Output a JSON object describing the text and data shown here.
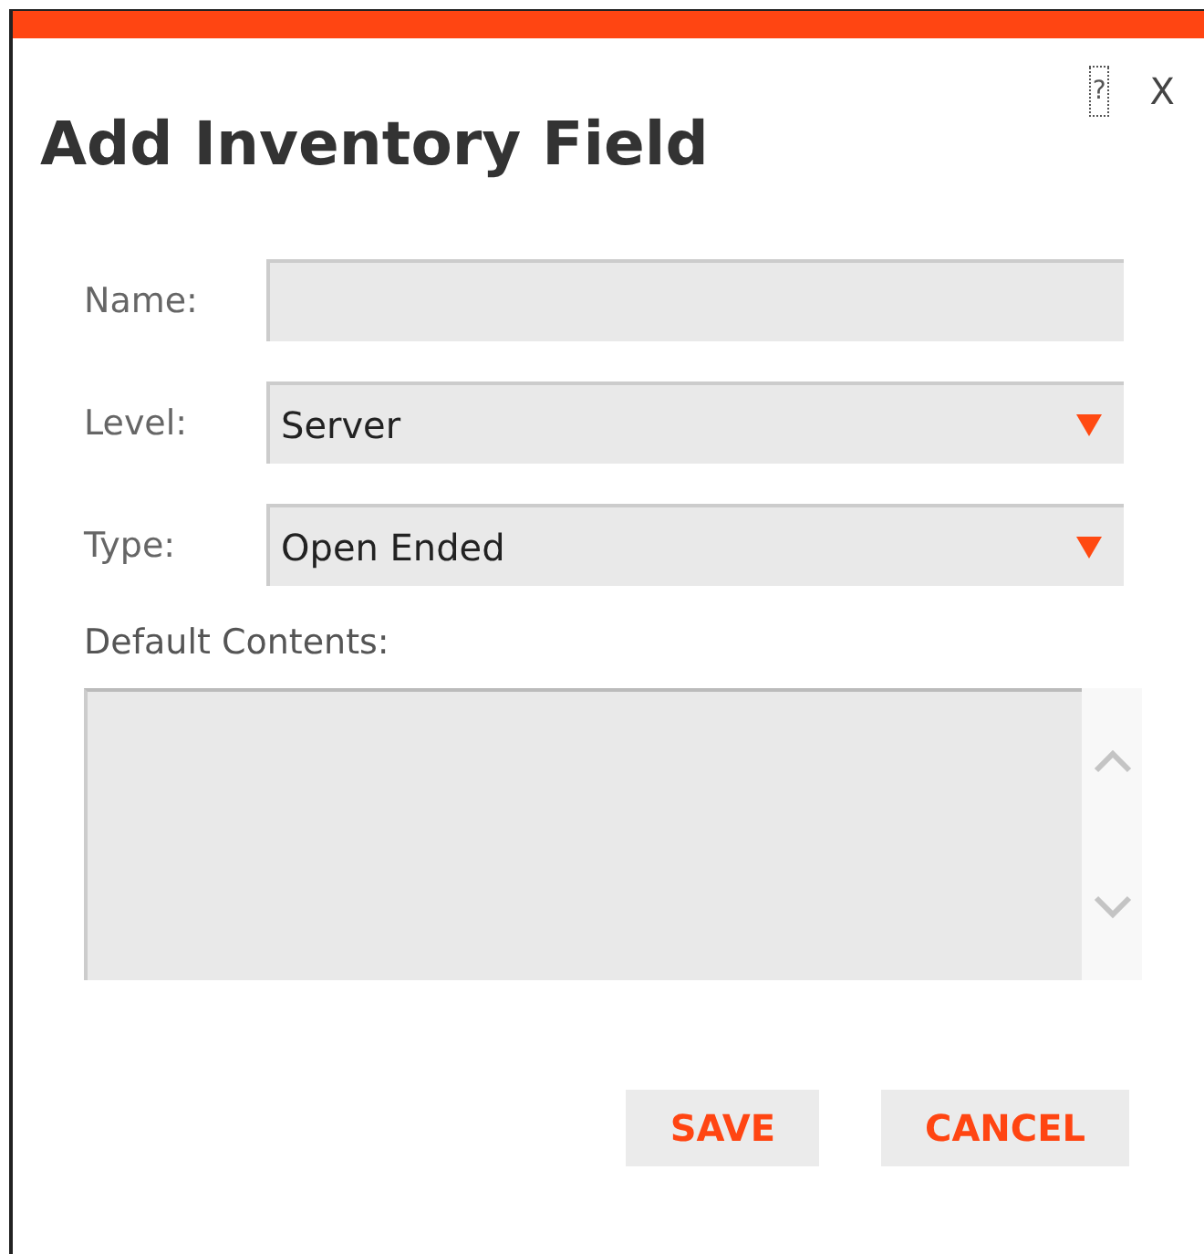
{
  "dialog": {
    "title": "Add Inventory Field",
    "help_icon": "?",
    "close_label": "X"
  },
  "fields": [
    {
      "kind": "text",
      "label": "Name:"
    },
    {
      "kind": "select",
      "label": "Level:",
      "value": "Server"
    },
    {
      "kind": "select",
      "label": "Type:",
      "value": "Open Ended"
    }
  ],
  "default_contents": {
    "label": "Default Contents:"
  },
  "buttons": [
    "SAVE",
    "CANCEL"
  ]
}
